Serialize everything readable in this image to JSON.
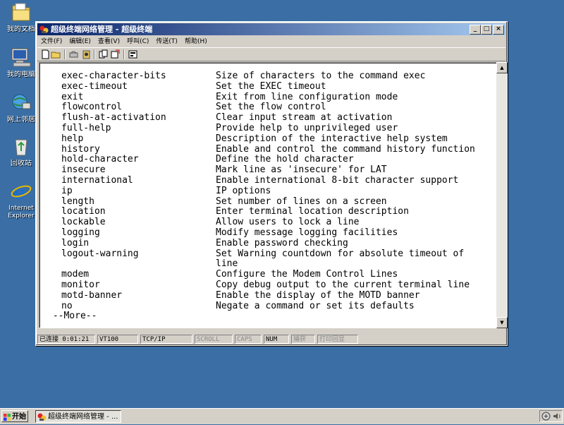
{
  "desktop": {
    "icons": [
      {
        "label": "我的文档",
        "icon": "my-documents-icon"
      },
      {
        "label": "我的电脑",
        "icon": "my-computer-icon"
      },
      {
        "label": "网上邻居",
        "icon": "network-places-icon"
      },
      {
        "label": "回收站",
        "icon": "recycle-bin-icon"
      },
      {
        "label": "Internet Explorer",
        "icon": "internet-explorer-icon"
      }
    ]
  },
  "window": {
    "title": "超级终端网络管理 - 超级终端",
    "menu": [
      "文件(F)",
      "编辑(E)",
      "查看(V)",
      "呼叫(C)",
      "传送(T)",
      "帮助(H)"
    ],
    "toolbar_icons": [
      "new-icon",
      "open-icon",
      "disconnect-icon",
      "dial-icon",
      "send-icon",
      "receive-icon",
      "properties-icon"
    ]
  },
  "terminal": {
    "rows": [
      {
        "cmd": "exec-character-bits",
        "desc": "Size of characters to the command exec"
      },
      {
        "cmd": "exec-timeout",
        "desc": "Set the EXEC timeout"
      },
      {
        "cmd": "exit",
        "desc": "Exit from line configuration mode"
      },
      {
        "cmd": "flowcontrol",
        "desc": "Set the flow control"
      },
      {
        "cmd": "flush-at-activation",
        "desc": "Clear input stream at activation"
      },
      {
        "cmd": "full-help",
        "desc": "Provide help to unprivileged user"
      },
      {
        "cmd": "help",
        "desc": "Description of the interactive help system"
      },
      {
        "cmd": "history",
        "desc": "Enable and control the command history function"
      },
      {
        "cmd": "hold-character",
        "desc": "Define the hold character"
      },
      {
        "cmd": "insecure",
        "desc": "Mark line as 'insecure' for LAT"
      },
      {
        "cmd": "international",
        "desc": "Enable international 8-bit character support"
      },
      {
        "cmd": "ip",
        "desc": "IP options"
      },
      {
        "cmd": "length",
        "desc": "Set number of lines on a screen"
      },
      {
        "cmd": "location",
        "desc": "Enter terminal location description"
      },
      {
        "cmd": "lockable",
        "desc": "Allow users to lock a line"
      },
      {
        "cmd": "logging",
        "desc": "Modify message logging facilities"
      },
      {
        "cmd": "login",
        "desc": "Enable password checking"
      },
      {
        "cmd": "logout-warning",
        "desc": "Set Warning countdown for absolute timeout of"
      },
      {
        "cmd": "",
        "desc": "line"
      },
      {
        "cmd": "modem",
        "desc": "Configure the Modem Control Lines"
      },
      {
        "cmd": "monitor",
        "desc": "Copy debug output to the current terminal line"
      },
      {
        "cmd": "motd-banner",
        "desc": "Enable the display of the MOTD banner"
      },
      {
        "cmd": "no",
        "desc": "Negate a command or set its defaults"
      }
    ],
    "more_prompt": " --More--"
  },
  "status": {
    "connected": "已连接 0:01:21",
    "emulation": "VT100",
    "protocol": "TCP/IP",
    "scroll": "SCROLL",
    "caps": "CAPS",
    "num": "NUM",
    "capture": "捕获",
    "print_echo": "打印回显"
  },
  "taskbar": {
    "start_label": "开始",
    "task_label": "超级终端网络管理 - ..."
  }
}
